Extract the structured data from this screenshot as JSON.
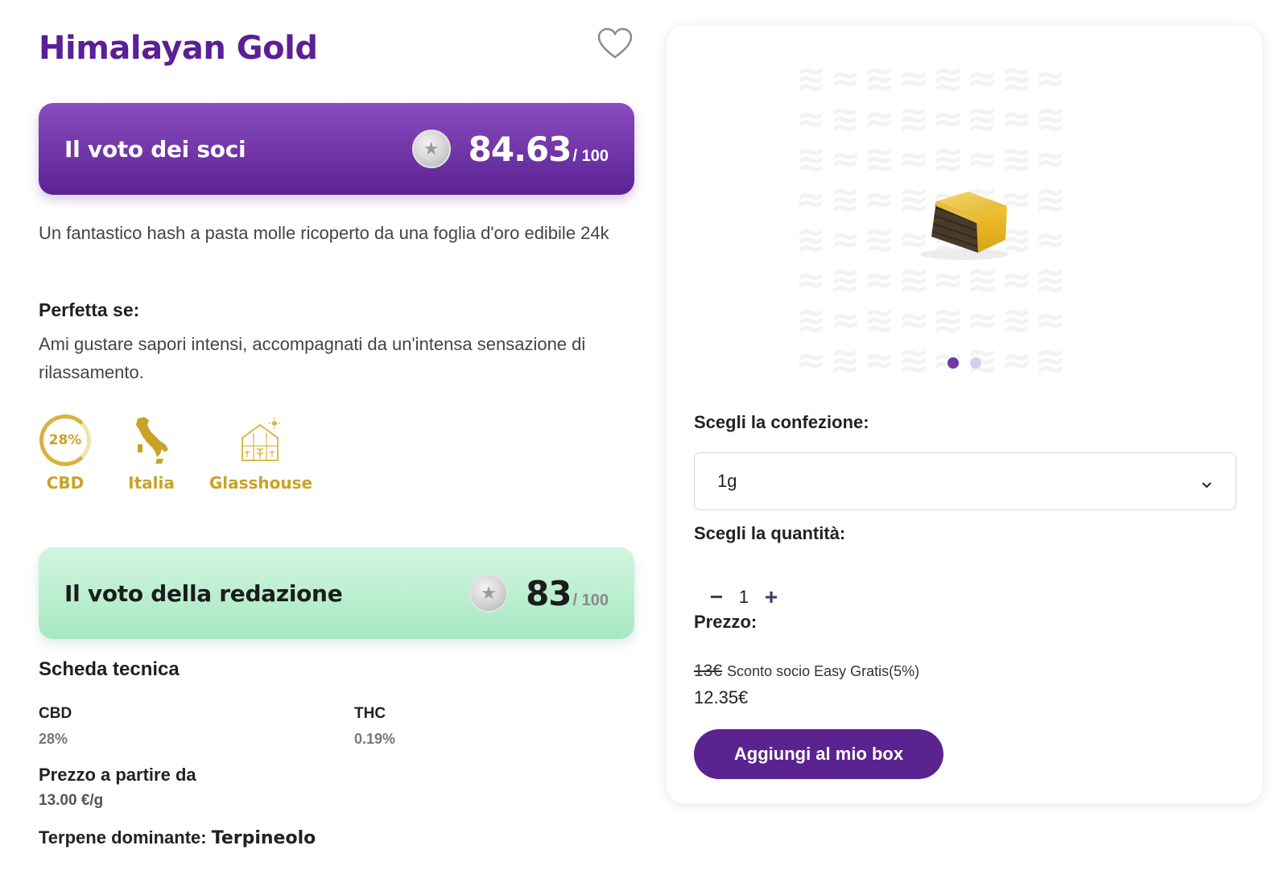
{
  "product": {
    "title": "Himalayan Gold",
    "description": "Un fantastico hash a pasta molle ricoperto da una foglia d'oro edibile 24k"
  },
  "vote_soci": {
    "label": "Il voto dei soci",
    "score": "84.63",
    "max": "/ 100"
  },
  "vote_redazione": {
    "label": "Il voto della redazione",
    "score": "83",
    "max": "/ 100"
  },
  "perfetta": {
    "heading": "Perfetta se:",
    "text": "Ami gustare sapori intensi, accompagnati da un'intensa sensazione di rilassamento."
  },
  "badges": {
    "cbd_percent": "28%",
    "cbd_label": "CBD",
    "origin_label": "Italia",
    "cultivation_label": "Glasshouse"
  },
  "scheda": {
    "heading": "Scheda tecnica",
    "cbd_label": "CBD",
    "cbd_value": "28%",
    "thc_label": "THC",
    "thc_value": "0.19%",
    "price_label": "Prezzo a partire da",
    "price_value": "13.00 €/g",
    "terpene_label": "Terpene dominante:",
    "terpene_value": "Terpineolo"
  },
  "purchase": {
    "confezione_label": "Scegli la confezione:",
    "confezione_value": "1g",
    "quantita_label": "Scegli la quantità:",
    "quantity": "1",
    "minus": "−",
    "plus": "+",
    "prezzo_label": "Prezzo:",
    "old_price": "13€",
    "discount_text": "Sconto socio Easy Gratis(5%)",
    "new_price": "12.35€",
    "add_button": "Aggiungi al mio box"
  },
  "gallery": {
    "active_slide": 1,
    "slide_count": 2
  },
  "colors": {
    "brand_purple": "#5b2390",
    "gold": "#c9a227",
    "mint": "#b7eecf"
  }
}
